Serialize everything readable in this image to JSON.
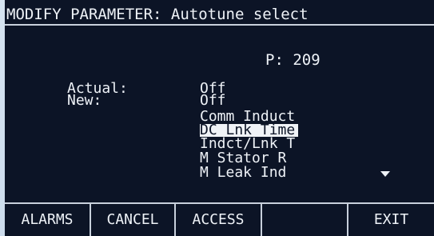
{
  "title": {
    "label": "MODIFY PARAMETER:",
    "value": "Autotune select"
  },
  "parameter_number": "P: 209",
  "actual": {
    "label": "Actual:",
    "value": "Off"
  },
  "new": {
    "label": "New:"
  },
  "options": [
    "Off",
    "Comm Induct",
    "DC Lnk Time",
    "Indct/Lnk T",
    "M Stator R",
    "M Leak Ind"
  ],
  "selected_option_index": 2,
  "softkeys": [
    "ALARMS",
    "CANCEL",
    "ACCESS",
    "",
    "EXIT"
  ]
}
